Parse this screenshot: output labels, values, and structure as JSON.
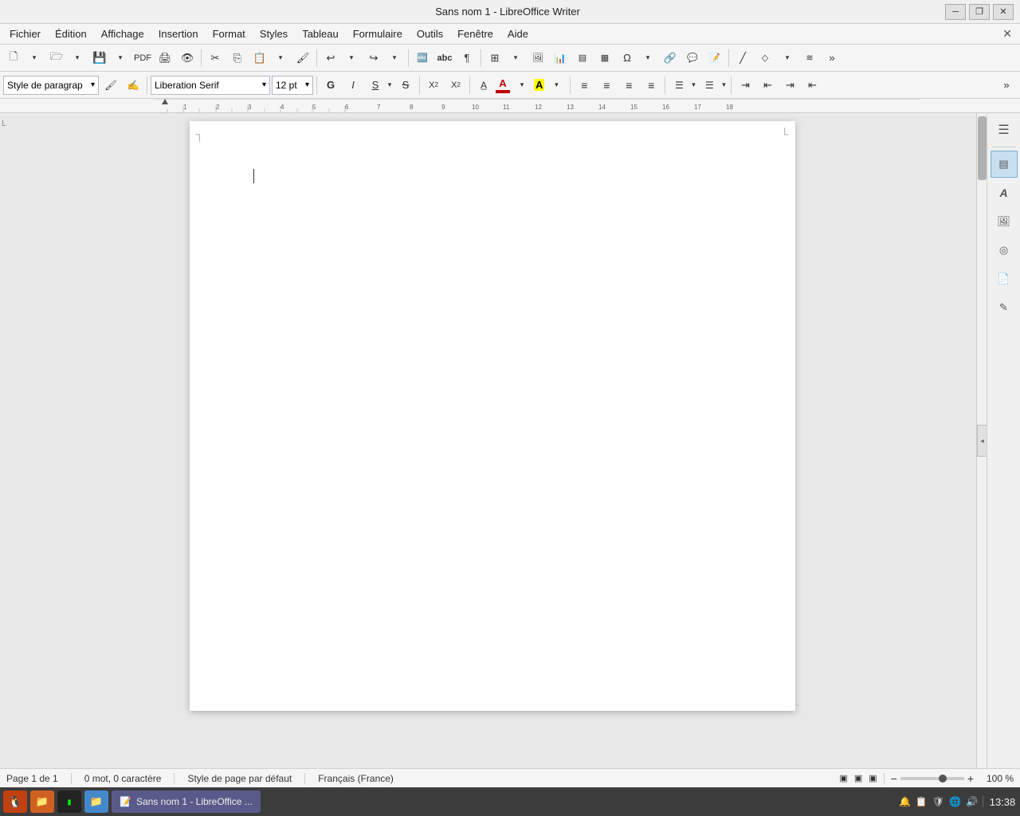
{
  "window": {
    "title": "Sans nom 1 - LibreOffice Writer",
    "close_btn": "✕",
    "minimize_btn": "─",
    "maximize_btn": "❐"
  },
  "menubar": {
    "items": [
      "Fichier",
      "Édition",
      "Affichage",
      "Insertion",
      "Format",
      "Styles",
      "Tableau",
      "Formulaire",
      "Outils",
      "Fenêtre",
      "Aide"
    ],
    "close_icon": "✕"
  },
  "toolbar1": {
    "buttons": [
      {
        "name": "new",
        "icon": "🗋"
      },
      {
        "name": "open",
        "icon": "🗁"
      },
      {
        "name": "save",
        "icon": "💾"
      },
      {
        "name": "export-pdf",
        "icon": "📄"
      },
      {
        "name": "print",
        "icon": "🖨"
      },
      {
        "name": "print-preview",
        "icon": "🔍"
      },
      {
        "name": "cut",
        "icon": "✂"
      },
      {
        "name": "copy",
        "icon": "⎘"
      },
      {
        "name": "paste",
        "icon": "📋"
      },
      {
        "name": "clone-format",
        "icon": "🖌"
      },
      {
        "name": "undo",
        "icon": "↩"
      },
      {
        "name": "redo",
        "icon": "↪"
      },
      {
        "name": "spellcheck",
        "icon": "🔤"
      },
      {
        "name": "spelling",
        "icon": "abc"
      },
      {
        "name": "show-formatting",
        "icon": "¶"
      },
      {
        "name": "table",
        "icon": "⊞"
      },
      {
        "name": "image",
        "icon": "🖼"
      },
      {
        "name": "chart",
        "icon": "📊"
      },
      {
        "name": "textbox",
        "icon": "▤"
      },
      {
        "name": "special-char",
        "icon": "Ω"
      },
      {
        "name": "hyperlink",
        "icon": "🔗"
      },
      {
        "name": "more",
        "icon": "»"
      }
    ]
  },
  "toolbar2": {
    "paragraph_style": {
      "value": "Style de paragraph",
      "arrow": "▾"
    },
    "font": {
      "value": "Liberation Serif",
      "arrow": "▾"
    },
    "size": {
      "value": "12 pt",
      "arrow": "▾"
    },
    "format_buttons": [
      {
        "name": "bold",
        "label": "G",
        "style": "bold"
      },
      {
        "name": "italic",
        "label": "I",
        "style": "italic"
      },
      {
        "name": "underline",
        "label": "S",
        "style": "underline"
      },
      {
        "name": "strikethrough",
        "label": "S",
        "style": "strike"
      },
      {
        "name": "superscript",
        "label": "X²"
      },
      {
        "name": "subscript",
        "label": "X₂"
      },
      {
        "name": "font-color",
        "label": "A",
        "color": "#e00000"
      },
      {
        "name": "highlight",
        "label": "A",
        "color": "#ffff00"
      },
      {
        "name": "align-left",
        "label": "≡"
      },
      {
        "name": "align-center",
        "label": "≡"
      },
      {
        "name": "align-right",
        "label": "≡"
      },
      {
        "name": "align-justify",
        "label": "≡"
      },
      {
        "name": "list-unordered",
        "label": "☰"
      },
      {
        "name": "list-ordered",
        "label": "☰"
      },
      {
        "name": "indent-more",
        "label": "⇥"
      },
      {
        "name": "indent-less",
        "label": "⇤"
      },
      {
        "name": "more",
        "label": "»"
      }
    ]
  },
  "ruler": {
    "marks": [
      "1",
      "2",
      "3",
      "4",
      "5",
      "6",
      "7",
      "8",
      "9",
      "10",
      "11",
      "12",
      "13",
      "14",
      "15",
      "16",
      "17",
      "18"
    ]
  },
  "sidebar": {
    "buttons": [
      {
        "name": "properties",
        "icon": "☰",
        "active": true
      },
      {
        "name": "styles",
        "icon": "A",
        "active": false
      },
      {
        "name": "gallery",
        "icon": "🖼",
        "active": false
      },
      {
        "name": "navigator",
        "icon": "◎",
        "active": false
      },
      {
        "name": "page-panel",
        "icon": "📄",
        "active": false
      },
      {
        "name": "design",
        "icon": "👁",
        "active": false
      }
    ]
  },
  "statusbar": {
    "page": "Page 1 de 1",
    "words": "0 mot, 0 caractère",
    "page_style": "Style de page par défaut",
    "language": "Français (France)",
    "view_icons": [
      "▣",
      "▣",
      "▣"
    ],
    "zoom_minus": "−",
    "zoom_plus": "+",
    "zoom_level": "100 %"
  },
  "taskbar": {
    "apps": [
      {
        "name": "start",
        "icon": "🐧",
        "color": "#e06020"
      },
      {
        "name": "files",
        "icon": "📁",
        "color": "#e06020"
      },
      {
        "name": "terminal",
        "icon": "■",
        "color": "#333"
      },
      {
        "name": "files2",
        "icon": "📁",
        "color": "#4488cc"
      }
    ],
    "window": "Sans nom 1 - LibreOffice ...",
    "time": "13:38",
    "systray": [
      "🔊",
      "🌐",
      "🛡",
      "📋"
    ]
  }
}
